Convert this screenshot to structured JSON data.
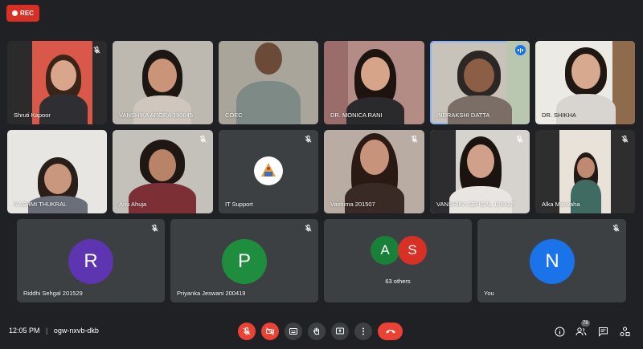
{
  "recording": {
    "label": "REC"
  },
  "participants": [
    {
      "name": "Shruti Kapoor"
    },
    {
      "name": "VANSHIKA ARORA 190645"
    },
    {
      "name": "COEC"
    },
    {
      "name": "DR. MONICA RANI"
    },
    {
      "name": "INDRAKSHI DATTA"
    },
    {
      "name": "DR. SHIKHA"
    },
    {
      "name": "RASHMI THUKRAL"
    },
    {
      "name": "Anu Ahuja"
    },
    {
      "name": "IT Support"
    },
    {
      "name": "Vashima 201507"
    },
    {
      "name": "VANSHIKA SEHGAL 190412"
    },
    {
      "name": "Alka Marwaha"
    },
    {
      "name": "Riddhi Sehgal 201529",
      "initial": "R",
      "color": "#5e35b1"
    },
    {
      "name": "Priyanka Jeswani 200419",
      "initial": "P",
      "color": "#1e8e3e"
    },
    {
      "name": "63 others",
      "initial_a": "A",
      "initial_b": "S",
      "color_a": "#188038",
      "color_b": "#d93025"
    },
    {
      "name": "You",
      "initial": "N",
      "color": "#1a73e8"
    }
  ],
  "meeting": {
    "time": "12:05 PM",
    "separator": "|",
    "code": "ogw-nxvb-dkb"
  },
  "people_count": "78",
  "colors": {
    "background": "#202124",
    "tile": "#3c4043",
    "danger": "#ea4335",
    "accent": "#1a73e8"
  },
  "icons": [
    "mic-off-icon",
    "camera-off-icon",
    "captions-icon",
    "raise-hand-icon",
    "present-icon",
    "more-options-icon",
    "end-call-icon",
    "info-icon",
    "people-icon",
    "chat-icon",
    "activities-icon"
  ]
}
